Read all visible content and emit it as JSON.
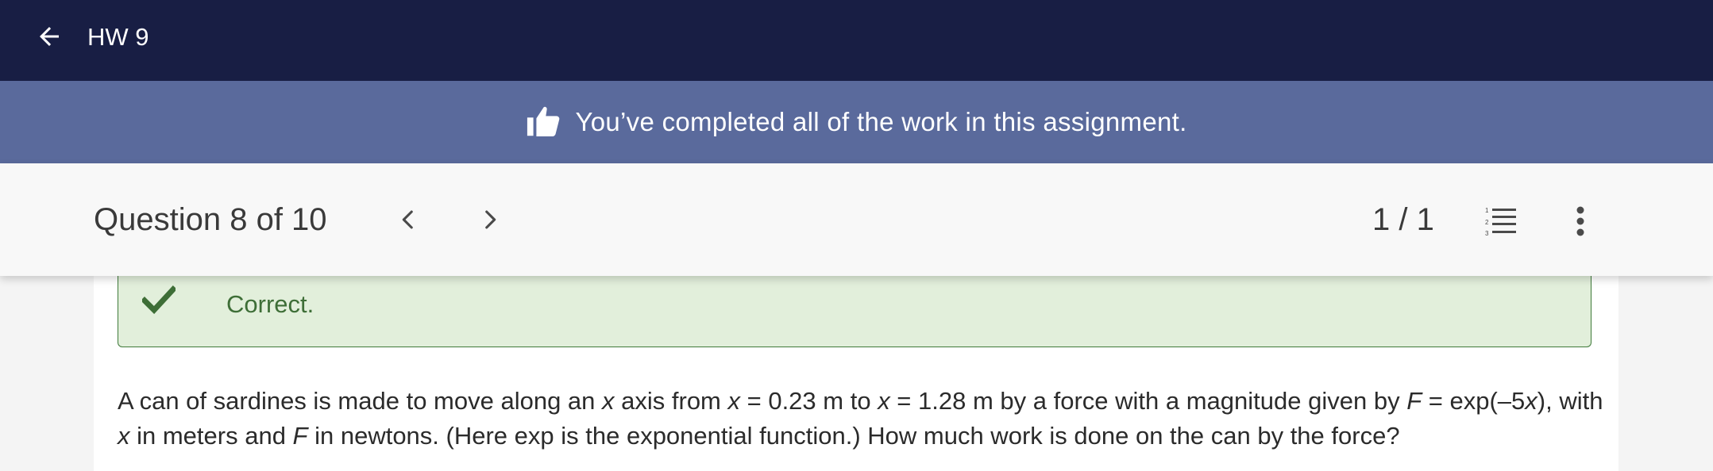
{
  "header": {
    "title": "HW 9",
    "back_icon": "arrow-left-icon"
  },
  "banner": {
    "icon": "thumbs-up-icon",
    "text": "You’ve completed all of the work in this assignment."
  },
  "question_nav": {
    "title": "Question 8 of 10",
    "prev_icon": "chevron-left-icon",
    "next_icon": "chevron-right-icon",
    "count": "1 / 1",
    "list_icon": "numbered-list-icon",
    "more_icon": "more-vertical-icon"
  },
  "feedback": {
    "icon": "checkmark-icon",
    "text": "Correct."
  },
  "question": {
    "p1": "A can of sardines is made to move along an ",
    "x1": "x",
    "p2": " axis from ",
    "x2": "x",
    "p3": " = 0.23 m to ",
    "x3": "x",
    "p4": " = 1.28 m by a force with a magnitude given by ",
    "F1": "F",
    "p5": " = exp(–5",
    "x4": "x",
    "p6": "), with ",
    "x5": "x",
    "p7": " in meters and ",
    "F2": "F",
    "p8": " in newtons. (Here exp is the exponential function.) How much work is done on the can by the force?"
  },
  "colors": {
    "topbar": "#181e44",
    "banner": "#5a6a9c",
    "success_bg": "#e2efdb",
    "success_border": "#3f7a3a",
    "success_text": "#3e6e37"
  }
}
